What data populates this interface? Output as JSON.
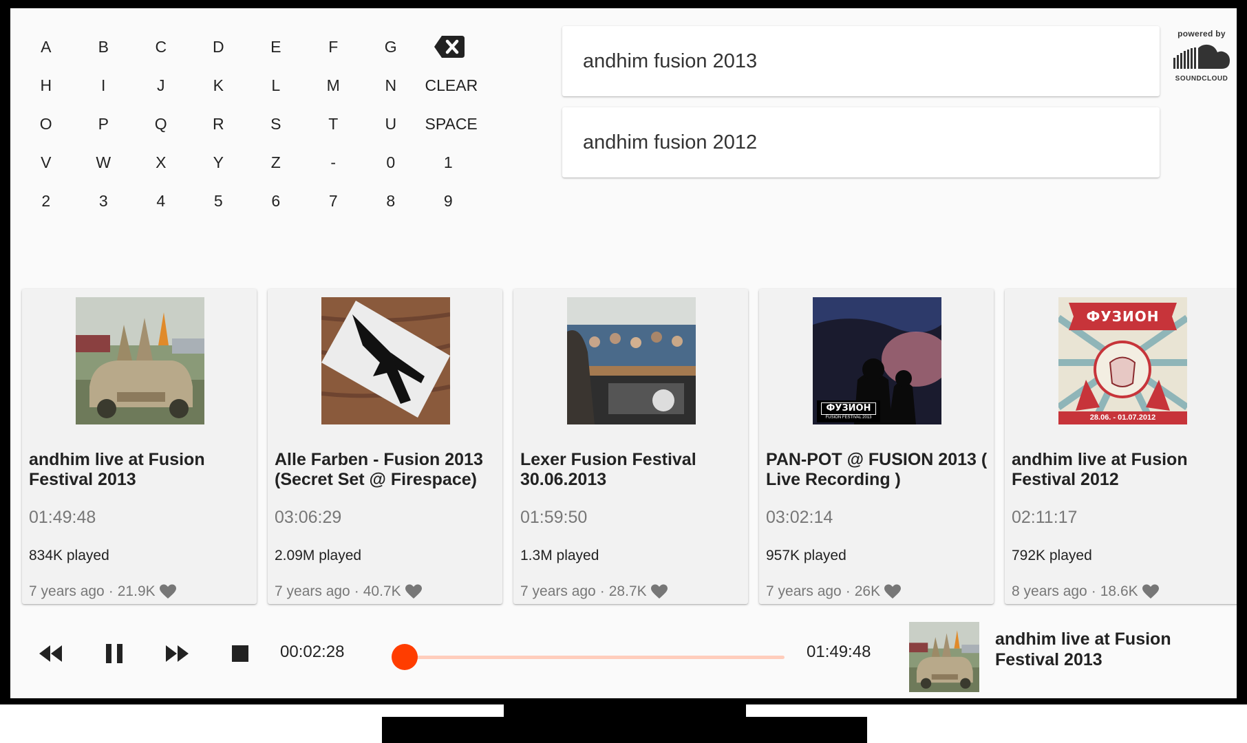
{
  "keyboard": {
    "rows": [
      [
        "A",
        "B",
        "C",
        "D",
        "E",
        "F",
        "G"
      ],
      [
        "H",
        "I",
        "J",
        "K",
        "L",
        "M",
        "N",
        "CLEAR"
      ],
      [
        "O",
        "P",
        "Q",
        "R",
        "S",
        "T",
        "U",
        "SPACE"
      ],
      [
        "V",
        "W",
        "X",
        "Y",
        "Z",
        "-",
        "0",
        "1"
      ],
      [
        "2",
        "3",
        "4",
        "5",
        "6",
        "7",
        "8",
        "9"
      ]
    ],
    "backspace_icon": "backspace-icon"
  },
  "suggestions": [
    "andhim fusion 2013",
    "andhim fusion 2012"
  ],
  "branding": {
    "powered_by": "powered by",
    "logo_text": "SOUNDCLOUD"
  },
  "tracks": [
    {
      "title": "andhim live at Fusion Festival 2013",
      "duration": "01:49:48",
      "plays": "834K played",
      "age": "7 years ago",
      "likes": "21.9K"
    },
    {
      "title": "Alle Farben - Fusion 2013 (Secret Set @ Firespace)",
      "duration": "03:06:29",
      "plays": "2.09M played",
      "age": "7 years ago",
      "likes": "40.7K"
    },
    {
      "title": "Lexer Fusion Festival 30.06.2013",
      "duration": "01:59:50",
      "plays": "1.3M played",
      "age": "7 years ago",
      "likes": "28.7K"
    },
    {
      "title": "PAN-POT @ FUSION 2013 ( Live Recording )",
      "duration": "03:02:14",
      "plays": "957K played",
      "age": "7 years ago",
      "likes": "26K"
    },
    {
      "title": "andhim live at Fusion Festival 2012",
      "duration": "02:11:17",
      "plays": "792K played",
      "age": "8 years ago",
      "likes": "18.6K"
    }
  ],
  "artwork_text": {
    "pan_pot_badge": "ФУЗИОН",
    "pan_pot_sub": "FUSION FESTIVAL 2013",
    "fusion2012_banner": "ФУЗИОН",
    "fusion2012_date": "28.06. - 01.07.2012"
  },
  "player": {
    "elapsed": "00:02:28",
    "total": "01:49:48",
    "progress": 0.0225,
    "now_playing_title": "andhim live at Fusion Festival 2013",
    "accent_color": "#ff3d00",
    "track_color": "#ffcdbc"
  }
}
